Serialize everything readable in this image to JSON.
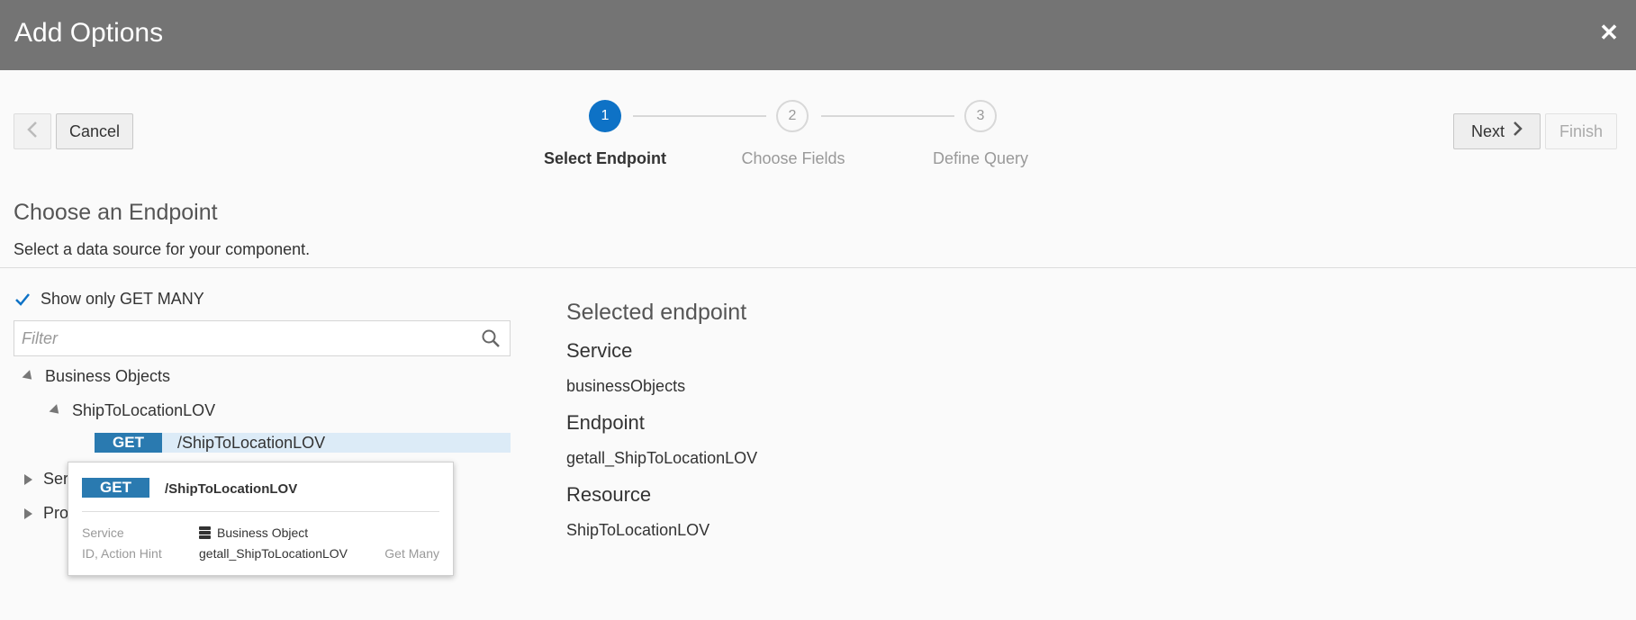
{
  "dialog": {
    "title": "Add Options",
    "close_icon": "close-icon"
  },
  "toolbar": {
    "back_icon": "chevron-left-icon",
    "cancel_label": "Cancel",
    "next_label": "Next",
    "next_icon": "chevron-right-icon",
    "finish_label": "Finish"
  },
  "steps": [
    {
      "number": "1",
      "label": "Select Endpoint",
      "state": "active"
    },
    {
      "number": "2",
      "label": "Choose Fields",
      "state": "todo"
    },
    {
      "number": "3",
      "label": "Define Query",
      "state": "todo"
    }
  ],
  "section": {
    "title": "Choose an Endpoint",
    "subtitle": "Select a data source for your component."
  },
  "filter": {
    "checkbox_label": "Show only GET MANY",
    "checkbox_checked": true,
    "placeholder": "Filter",
    "value": ""
  },
  "tree": {
    "root_business_objects": "Business Objects",
    "child_shiptolocation": "ShipToLocationLOV",
    "endpoint_method": "GET",
    "endpoint_path": "/ShipToLocationLOV",
    "root_services": "Services",
    "root_process": "Process"
  },
  "popup": {
    "method": "GET",
    "path": "/ShipToLocationLOV",
    "service_label": "Service",
    "service_value": "Business Object",
    "service_icon": "database-icon",
    "id_label": "ID, Action Hint",
    "id_value": "getall_ShipToLocationLOV",
    "hint": "Get Many"
  },
  "selected": {
    "title": "Selected endpoint",
    "service_heading": "Service",
    "service_value": "businessObjects",
    "endpoint_heading": "Endpoint",
    "endpoint_value": "getall_ShipToLocationLOV",
    "resource_heading": "Resource",
    "resource_value": "ShipToLocationLOV"
  },
  "colors": {
    "header_bg": "#747474",
    "accent": "#0e72c6",
    "get_badge": "#2a7ab0",
    "selected_row": "#dcebf7"
  }
}
